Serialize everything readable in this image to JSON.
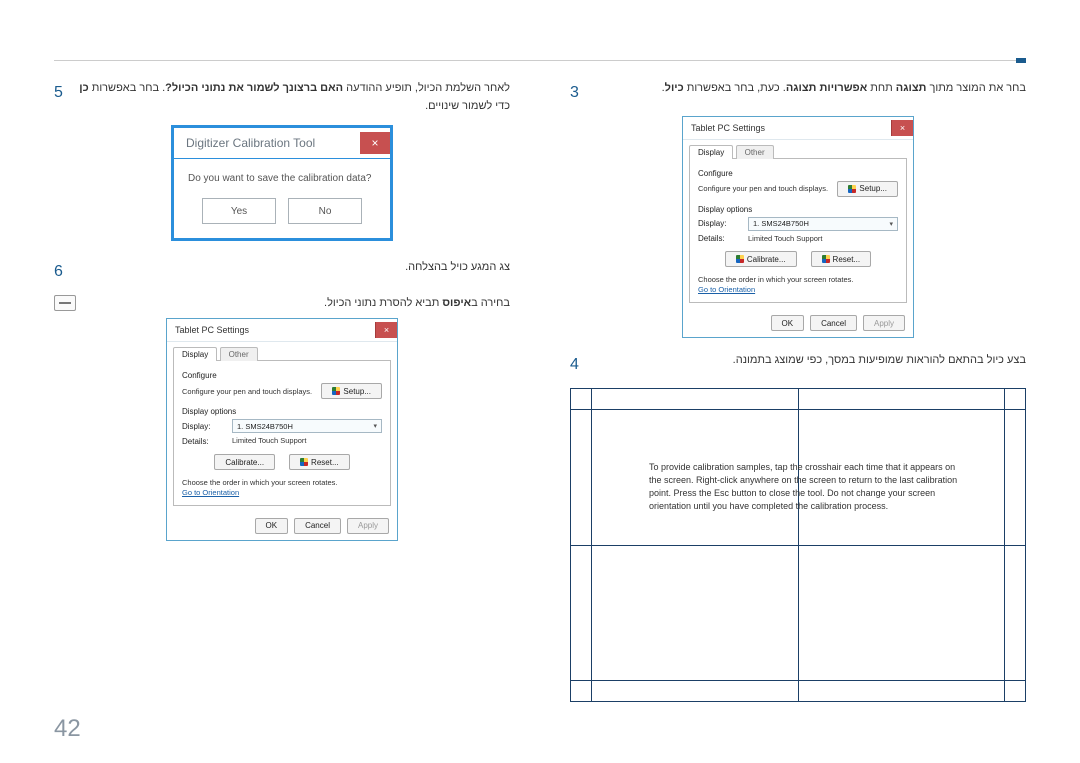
{
  "page_number": "42",
  "right_column": {
    "step3": {
      "num": "3",
      "pre": "בחר את המוצר מתוך ",
      "b1": "תצוגה",
      "mid1": " תחת ",
      "b2": "אפשרויות תצוגה",
      "mid2": ". כעת, בחר באפשרות ",
      "b3": "כיול",
      "post": "."
    },
    "tablet1": {
      "title": "Tablet PC Settings",
      "close": "×",
      "tab_display": "Display",
      "tab_other": "Other",
      "configure": "Configure",
      "configure_text": "Configure your pen and touch displays.",
      "setup_btn": "Setup...",
      "display_options": "Display options",
      "display_label": "Display:",
      "display_value": "1. SMS24B750H",
      "details_label": "Details:",
      "details_value": "Limited Touch Support",
      "calibrate_btn": "Calibrate...",
      "reset_btn": "Reset...",
      "rotate_text": "Choose the order in which your screen rotates.",
      "orient_link": "Go to Orientation",
      "ok": "OK",
      "cancel": "Cancel",
      "apply": "Apply"
    },
    "step4": {
      "num": "4",
      "text": "בצע כיול בהתאם להוראות שמופיעות במסך, כפי שמוצג בתמונה."
    },
    "calib_msg": "To provide calibration samples, tap the crosshair each time that it appears on the screen.\nRight-click anywhere on the screen to return to the last calibration point. Press the Esc button to close the tool. Do not change your screen orientation until you have completed the calibration process."
  },
  "left_column": {
    "step5": {
      "num": "5",
      "pre": "לאחר השלמת הכיול, תופיע ההודעה ",
      "b1": "האם ברצונך לשמור את נתוני הכיול?",
      "mid": ". בחר באפשרות ",
      "b2": "כן",
      "post": " כדי לשמור שינויים."
    },
    "save_dlg": {
      "title": "Digitizer Calibration Tool",
      "close": "×",
      "body": "Do you want to save the calibration data?",
      "yes": "Yes",
      "no": "No"
    },
    "step6": {
      "num": "6",
      "text": "צג המגע כויל בהצלחה."
    },
    "note": {
      "pre": "בחירה ב",
      "b": "איפוס",
      "post": " תביא להסרת נתוני הכיול."
    },
    "tablet2": {
      "title": "Tablet PC Settings",
      "close": "×",
      "tab_display": "Display",
      "tab_other": "Other",
      "configure": "Configure",
      "configure_text": "Configure your pen and touch displays.",
      "setup_btn": "Setup...",
      "display_options": "Display options",
      "display_label": "Display:",
      "display_value": "1. SMS24B750H",
      "details_label": "Details:",
      "details_value": "Limited Touch Support",
      "calibrate_btn": "Calibrate...",
      "reset_btn": "Reset...",
      "rotate_text": "Choose the order in which your screen rotates.",
      "orient_link": "Go to Orientation",
      "ok": "OK",
      "cancel": "Cancel",
      "apply": "Apply"
    }
  }
}
